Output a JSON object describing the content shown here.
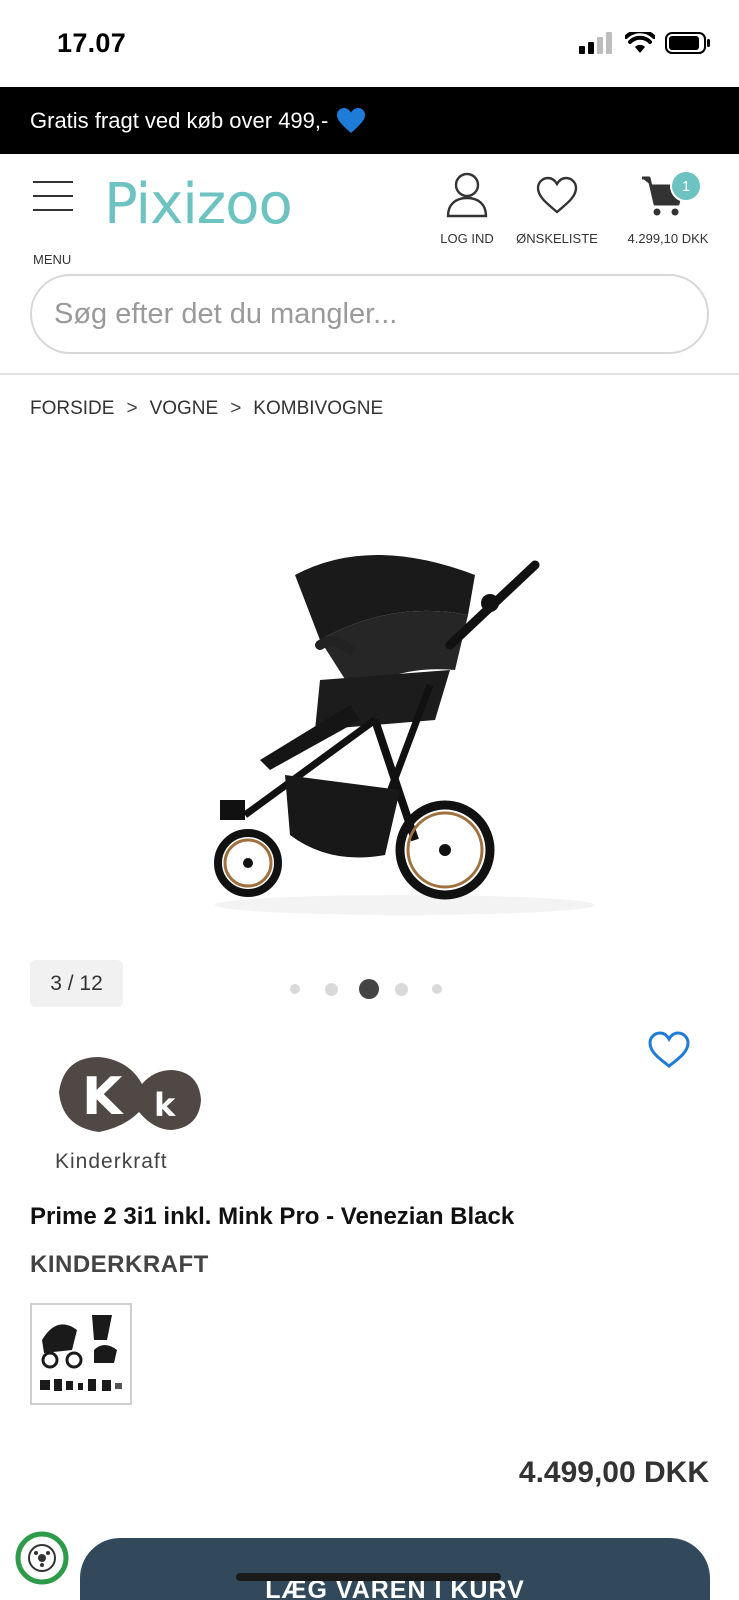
{
  "status": {
    "time": "17.07"
  },
  "promo": {
    "text": "Gratis fragt ved køb over 499,-"
  },
  "header": {
    "menu_label": "MENU",
    "logo_text": "Pixizoo",
    "login_label": "LOG IND",
    "wishlist_label": "ØNSKELISTE",
    "cart_total": "4.299,10 DKK",
    "cart_count": "1"
  },
  "search": {
    "placeholder": "Søg efter det du mangler..."
  },
  "breadcrumb": {
    "items": [
      "FORSIDE",
      "VOGNE",
      "KOMBIVOGNE"
    ],
    "separator": ">"
  },
  "gallery": {
    "counter": "3 / 12",
    "active_dot": 3,
    "dot_count": 5
  },
  "product": {
    "brand_logo_text": "Kinderkraft",
    "title": "Prime 2 3i1 inkl. Mink Pro - Venezian Black",
    "brand": "KINDERKRAFT",
    "price": "4.499,00 DKK",
    "add_to_cart": "LÆG VAREN I KURV"
  },
  "colors": {
    "accent": "#6cc3c1",
    "promo_bg": "#000000",
    "button_bg": "#31495a",
    "heart_blue": "#1f7bd8"
  },
  "icons": [
    "menu-icon",
    "user-icon",
    "heart-icon",
    "cart-icon",
    "wishlist-heart-icon",
    "recycle-icon",
    "blue-heart-emoji"
  ]
}
